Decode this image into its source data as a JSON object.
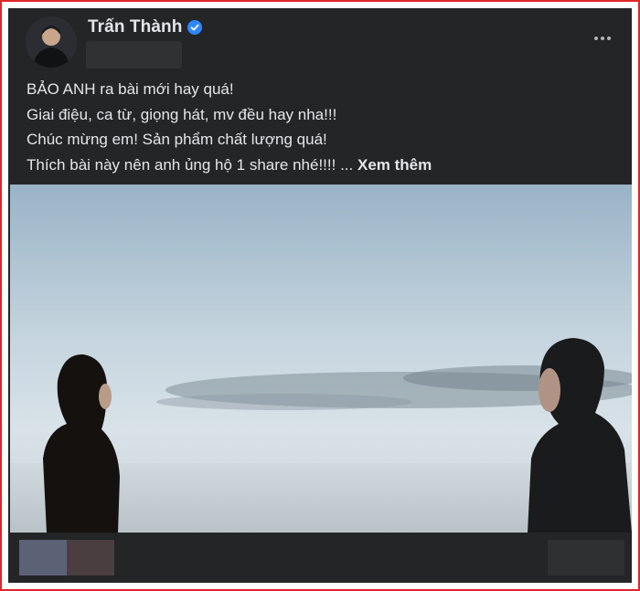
{
  "post": {
    "author": "Trấn Thành",
    "verified": true,
    "text_lines": [
      "BẢO ANH ra bài mới hay quá!",
      "Giai điệu, ca từ, giọng hát, mv đều hay nha!!!",
      "Chúc mừng em! Sản phẩm chất lượng quá!",
      "Thích bài này nên anh ủng hộ 1 share nhé!!!! ... "
    ],
    "see_more": "Xem thêm"
  },
  "icons": {
    "verified": "verified-badge-icon",
    "more": "more-options-icon"
  },
  "colors": {
    "highlight_border": "#e0262a",
    "card_bg": "#242526",
    "text": "#e4e6eb",
    "verified_blue": "#2d88ff"
  }
}
